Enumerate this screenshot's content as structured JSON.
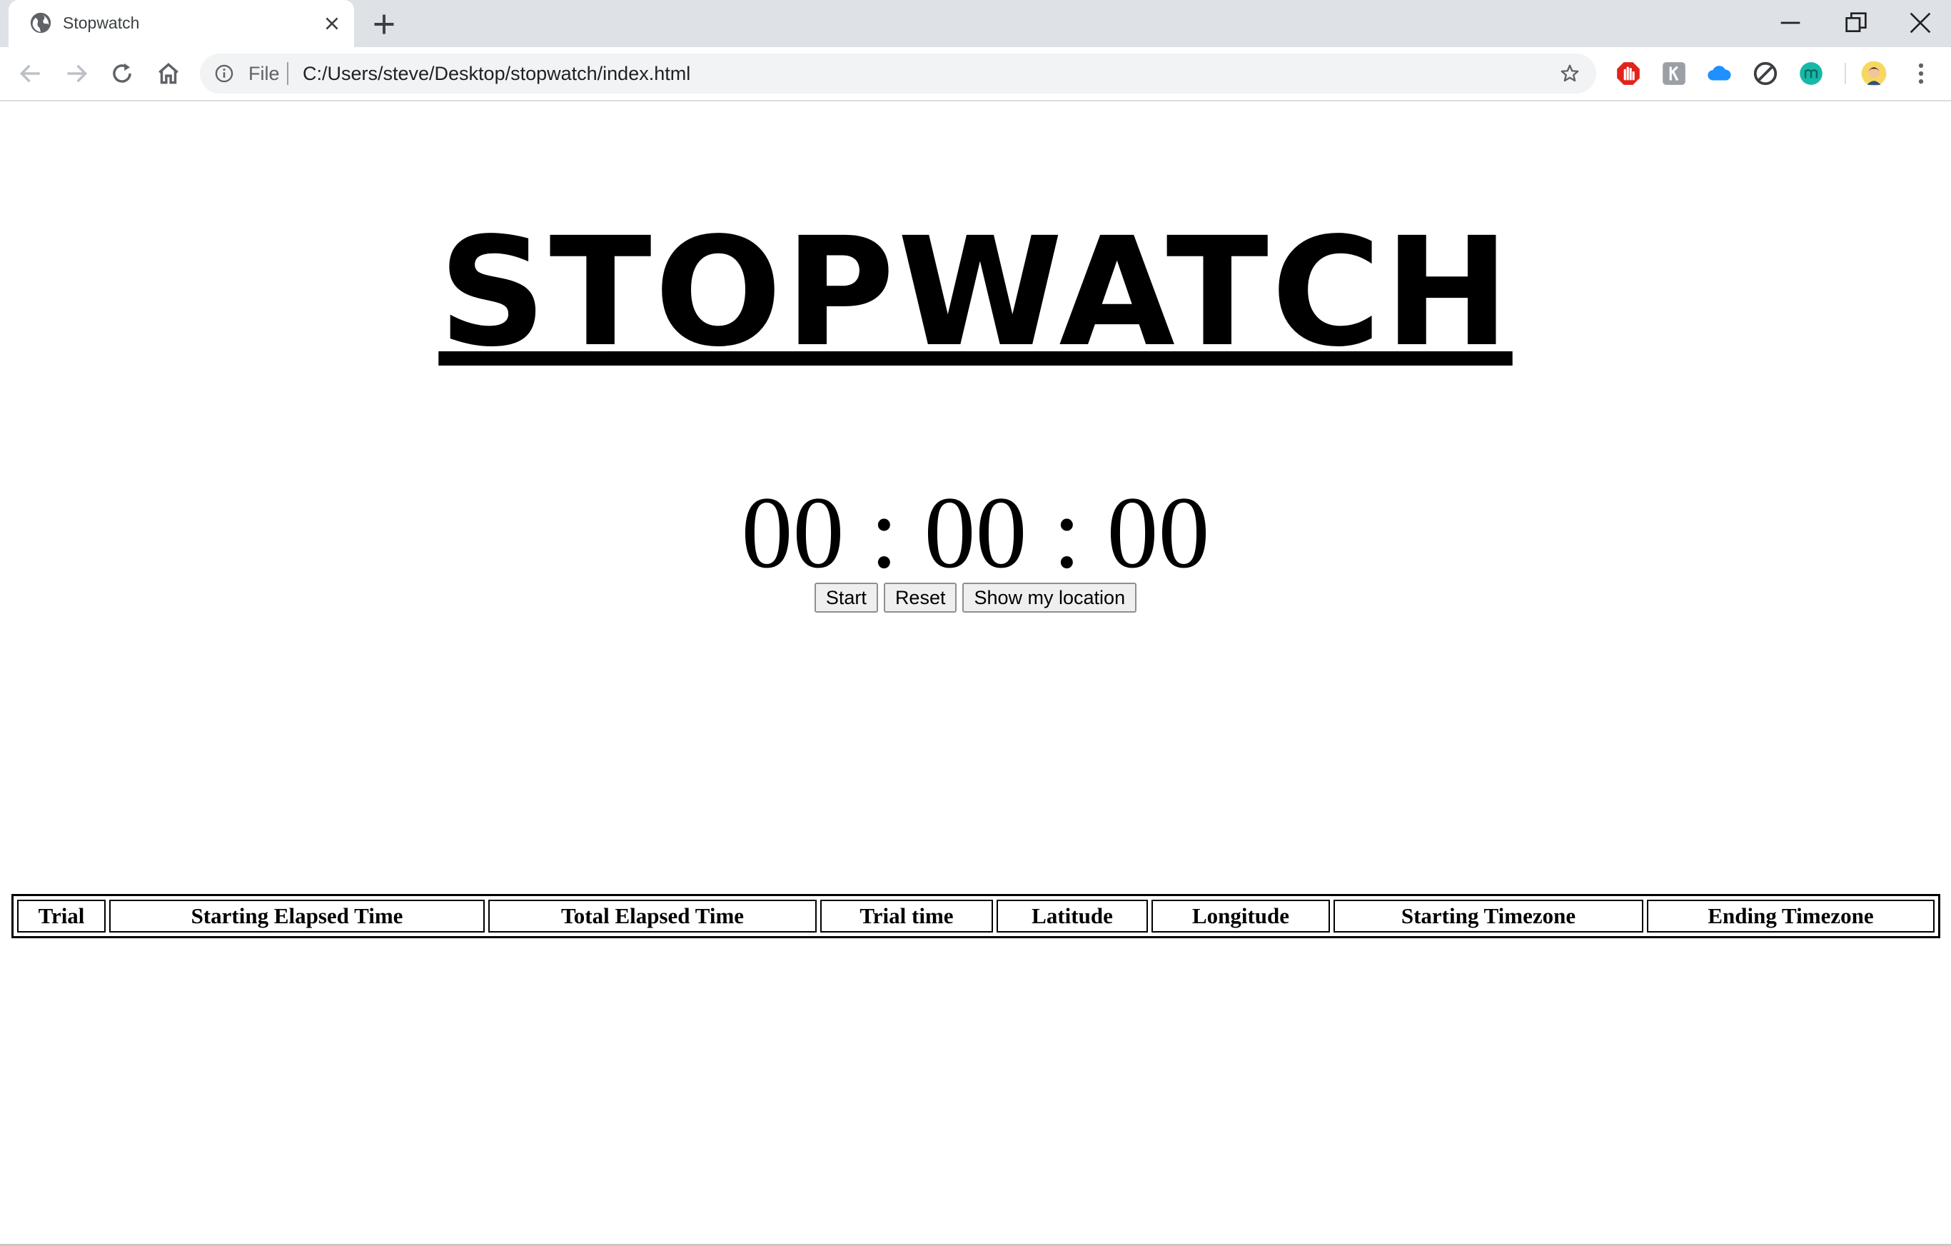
{
  "browser": {
    "tab": {
      "title": "Stopwatch"
    },
    "address_bar": {
      "scheme_label": "File",
      "url": "C:/Users/steve/Desktop/stopwatch/index.html"
    }
  },
  "page": {
    "title": "STOPWATCH",
    "timer": {
      "hours": "00",
      "minutes": "00",
      "seconds": "00",
      "separator": ":"
    },
    "buttons": {
      "start": "Start",
      "reset": "Reset",
      "show_location": "Show my location"
    },
    "table": {
      "headers": [
        "Trial",
        "Starting Elapsed Time",
        "Total Elapsed Time",
        "Trial time",
        "Latitude",
        "Longitude",
        "Starting Timezone",
        "Ending Timezone"
      ]
    }
  }
}
